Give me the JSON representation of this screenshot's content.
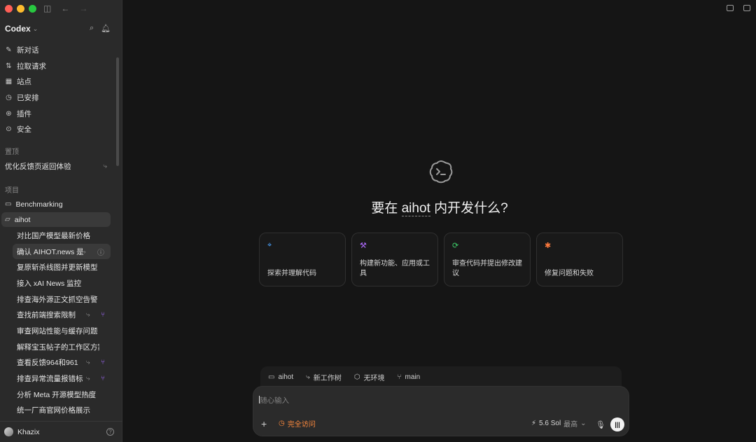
{
  "sidebar": {
    "brand": "Codex",
    "nav": [
      {
        "label": "新对话",
        "icon": "edit-icon"
      },
      {
        "label": "拉取请求",
        "icon": "pull-request-icon"
      },
      {
        "label": "站点",
        "icon": "sites-icon"
      },
      {
        "label": "已安排",
        "icon": "clock-icon"
      },
      {
        "label": "插件",
        "icon": "plugin-icon"
      },
      {
        "label": "安全",
        "icon": "shield-icon"
      }
    ],
    "pinned_label": "置顶",
    "pinned_item": "优化反馈页返回体验",
    "projects_label": "项目",
    "projects": [
      "Benchmarking",
      "aihot"
    ],
    "threads": [
      {
        "label": "对比国产模型最新价格"
      },
      {
        "label": "确认 AIHOT.news 是"
      },
      {
        "label": "复原斩杀线图并更新模型"
      },
      {
        "label": "接入 xAI News 监控"
      },
      {
        "label": "排查海外源正文抓空告警"
      },
      {
        "label": "查找前端搜索限制"
      },
      {
        "label": "审查网站性能与缓存问题"
      },
      {
        "label": "解释宝玉帖子的工作区方案"
      },
      {
        "label": "查看反馈964和961"
      },
      {
        "label": "排查异常流量报错标"
      },
      {
        "label": "分析 Meta 开源模型热度"
      },
      {
        "label": "统一厂商官网价格展示"
      }
    ],
    "user": "Khazix"
  },
  "main": {
    "headline_prefix": "要在 ",
    "headline_project": "aihot",
    "headline_suffix": " 内开发什么?",
    "cards": [
      {
        "label": "探索并理解代码",
        "icon": "telescope-icon",
        "color": "#4aa3ff"
      },
      {
        "label": "构建新功能、应用或工具",
        "icon": "hammer-icon",
        "color": "#b06bff"
      },
      {
        "label": "审查代码并提出修改建议",
        "icon": "review-icon",
        "color": "#3ecf6a"
      },
      {
        "label": "修复问题和失败",
        "icon": "bug-icon",
        "color": "#ff7a3d"
      }
    ],
    "context": {
      "project": "aihot",
      "worktree": "新工作树",
      "environment": "无环境",
      "branch": "main"
    },
    "composer": {
      "placeholder": "随心输入",
      "access": "完全访问",
      "model": "5.6 Sol",
      "effort": "最高"
    }
  }
}
